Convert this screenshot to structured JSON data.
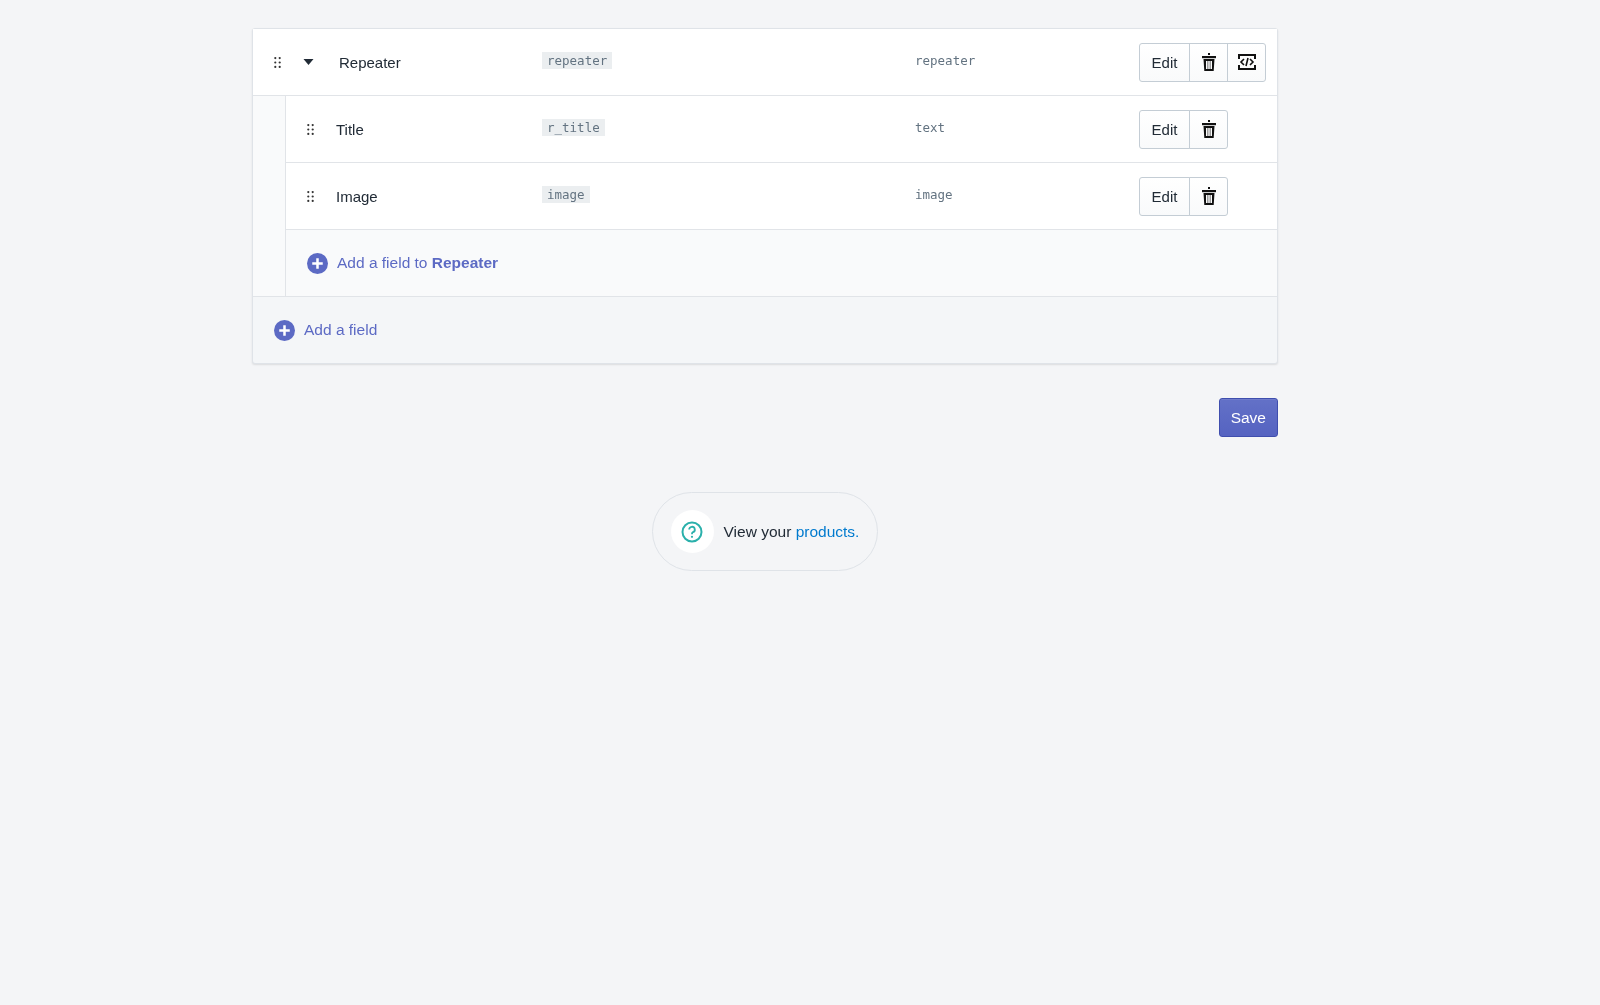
{
  "fields": [
    {
      "label": "Repeater",
      "key": "repeater",
      "type": "repeater",
      "expanded": true,
      "actions": [
        {
          "kind": "edit",
          "label": "Edit"
        },
        {
          "kind": "delete"
        },
        {
          "kind": "code"
        }
      ],
      "children": [
        {
          "label": "Title",
          "key": "r_title",
          "type": "text",
          "actions": [
            {
              "kind": "edit",
              "label": "Edit"
            },
            {
              "kind": "delete"
            }
          ]
        },
        {
          "label": "Image",
          "key": "image",
          "type": "image",
          "actions": [
            {
              "kind": "edit",
              "label": "Edit"
            },
            {
              "kind": "delete"
            }
          ]
        }
      ],
      "add_child": "Add a field to **Repeater**"
    }
  ],
  "add_field": "Add a field",
  "save": "Save",
  "help": {
    "text": "View your",
    "link": "products."
  }
}
